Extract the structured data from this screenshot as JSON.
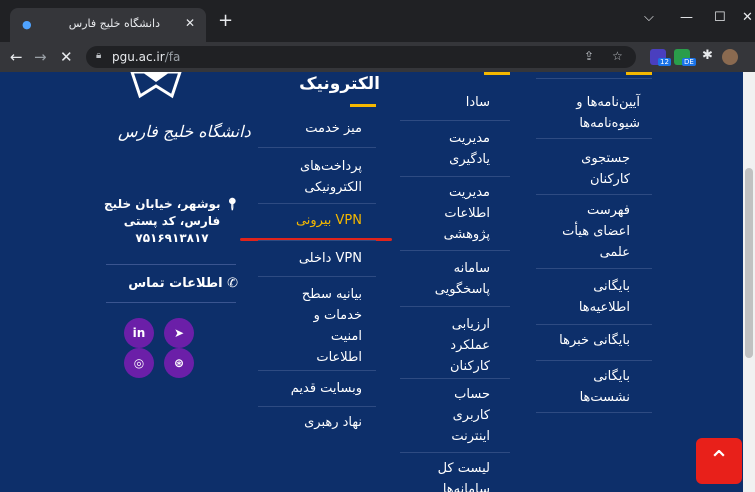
{
  "browser": {
    "tab_title": "دانشگاه خلیج فارس",
    "tab_close": "✕",
    "new_tab": "+",
    "url_host": "pgu.ac.ir",
    "url_path": "/fa",
    "window": {
      "minimize": "—",
      "maximize": "☐",
      "close": "✕",
      "dropdown": "⌵"
    },
    "nav": {
      "back": "←",
      "forward": "→",
      "stop": "✕"
    },
    "extensions": {
      "ext1_badge": "12",
      "ext2_badge": "DE"
    }
  },
  "footer": {
    "address_lines": [
      "بوشهر، خیابان خلیج",
      "فارس، کد پستی",
      "۷۵۱۶۹۱۳۸۱۷"
    ],
    "contact_label": "اطلاعات تماس",
    "logo_text": "دانشگاه خلیج فارس",
    "social": {
      "linkedin": "in",
      "telegram": "➤",
      "instagram": "◎",
      "aparat": "⊛"
    },
    "scroll_top": "⌃"
  },
  "menu": {
    "col_electronic": {
      "title": "الکترونیک",
      "items": [
        "میز خدمت",
        "پرداخت‌های",
        "الکترونیکی",
        "VPN بیرونی",
        "VPN داخلی",
        "بیانیه سطح",
        "خدمات و",
        "امنیت",
        "اطلاعات",
        "وبسایت قدیم",
        "نهاد رهبری"
      ]
    },
    "col_systems": {
      "items": [
        "سادا",
        "مدیریت",
        "یادگیری",
        "مدیریت",
        "اطلاعات",
        "پژوهشی",
        "سامانه",
        "پاسخگویی",
        "ارزیابی",
        "عملکرد",
        "کارکنان",
        "حساب",
        "کاربری",
        "اینترنت",
        "لیست کل",
        "سامانه‌ها"
      ]
    },
    "col_regulations": {
      "items": [
        "آیین‌نامه‌ها و",
        "شیوه‌نامه‌ها",
        "جستجوی",
        "کارکنان",
        "فهرست",
        "اعضای هیأت",
        "علمی",
        "بایگانی",
        "اطلاعیه‌ها",
        "بایگانی خبرها",
        "بایگانی",
        "نشست‌ها"
      ]
    }
  }
}
